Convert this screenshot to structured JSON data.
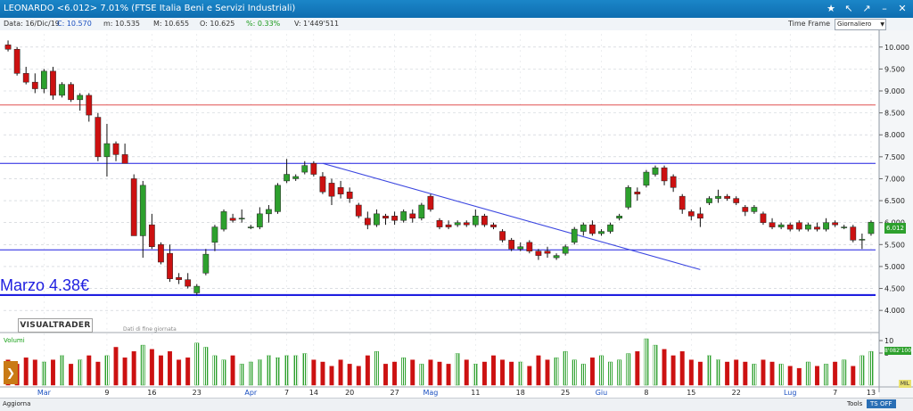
{
  "window": {
    "title": "LEONARDO <6.012> 7.01%   (FTSE Italia Beni e Servizi Industriali)"
  },
  "info": {
    "data": "Data: 16/Dic/19",
    "close": "C: 10.570",
    "min": "m: 10.535",
    "max": "M: 10.655",
    "open": "O: 10.625",
    "pct": "%: 0.33%",
    "volume": "V: 1'449'511"
  },
  "timeframe": {
    "label": "Time Frame",
    "value": "Giornaliero"
  },
  "logo": {
    "name": "VISUALTRADER",
    "sub": "Dati di fine giornata"
  },
  "annotation": "Marzo 4.38€",
  "volume_label": "Volumi",
  "status": {
    "aggiorna": "Aggiorna",
    "tools": "Tools",
    "tsoff": "TS OFF"
  },
  "tags": {
    "price": "6.012",
    "volume": "8'082'100",
    "mil": "MIL"
  },
  "colors": {
    "up": "#2da02d",
    "down": "#cc1111",
    "trend": "#3b46e0",
    "support": "#1f1fe0",
    "resistance": "#e05050"
  },
  "chart_data": {
    "type": "candlestick",
    "ylim": [
      3.8,
      10.3
    ],
    "yticks": [
      "10.000",
      "9.500",
      "9.000",
      "8.500",
      "8.000",
      "7.500",
      "7.000",
      "6.500",
      "6.000",
      "5.500",
      "5.000",
      "4.500",
      "4.000"
    ],
    "x_ticks": [
      {
        "label": "Mar",
        "i": 4
      },
      {
        "label": "9",
        "i": 11
      },
      {
        "label": "16",
        "i": 16
      },
      {
        "label": "23",
        "i": 21
      },
      {
        "label": "Apr",
        "i": 27
      },
      {
        "label": "7",
        "i": 31
      },
      {
        "label": "14",
        "i": 34
      },
      {
        "label": "20",
        "i": 38
      },
      {
        "label": "27",
        "i": 43
      },
      {
        "label": "Mag",
        "i": 47
      },
      {
        "label": "11",
        "i": 52
      },
      {
        "label": "18",
        "i": 57
      },
      {
        "label": "25",
        "i": 62
      },
      {
        "label": "Giu",
        "i": 66
      },
      {
        "label": "8",
        "i": 71
      },
      {
        "label": "15",
        "i": 76
      },
      {
        "label": "22",
        "i": 81
      },
      {
        "label": "Lug",
        "i": 87
      },
      {
        "label": "7",
        "i": 92
      },
      {
        "label": "13",
        "i": 96
      }
    ],
    "ohlc": [
      [
        10.05,
        10.15,
        9.9,
        9.95
      ],
      [
        9.95,
        10.0,
        9.35,
        9.4
      ],
      [
        9.4,
        9.55,
        9.15,
        9.2
      ],
      [
        9.2,
        9.4,
        8.95,
        9.05
      ],
      [
        9.05,
        9.5,
        8.95,
        9.45
      ],
      [
        9.45,
        9.55,
        8.8,
        8.9
      ],
      [
        8.9,
        9.2,
        8.85,
        9.15
      ],
      [
        9.15,
        9.2,
        8.75,
        8.8
      ],
      [
        8.8,
        8.95,
        8.55,
        8.9
      ],
      [
        8.9,
        8.95,
        8.3,
        8.45
      ],
      [
        8.4,
        8.5,
        7.4,
        7.5
      ],
      [
        7.5,
        8.25,
        7.05,
        7.8
      ],
      [
        7.8,
        7.85,
        7.4,
        7.55
      ],
      [
        7.55,
        7.8,
        7.4,
        7.35
      ],
      [
        7.0,
        7.1,
        5.7,
        5.7
      ],
      [
        5.7,
        6.95,
        5.2,
        6.85
      ],
      [
        5.95,
        6.2,
        5.4,
        5.45
      ],
      [
        5.5,
        5.55,
        5.05,
        5.1
      ],
      [
        5.3,
        5.5,
        4.65,
        4.72
      ],
      [
        4.75,
        4.85,
        4.6,
        4.7
      ],
      [
        4.7,
        4.85,
        4.5,
        4.55
      ],
      [
        4.4,
        4.6,
        4.35,
        4.55
      ],
      [
        4.85,
        5.4,
        4.8,
        5.28
      ],
      [
        5.55,
        5.95,
        5.35,
        5.9
      ],
      [
        5.85,
        6.3,
        5.8,
        6.25
      ],
      [
        6.1,
        6.2,
        6.0,
        6.05
      ],
      [
        6.1,
        6.3,
        6.0,
        6.1
      ],
      [
        5.9,
        5.95,
        5.85,
        5.9
      ],
      [
        5.9,
        6.35,
        5.85,
        6.2
      ],
      [
        6.2,
        6.4,
        6.0,
        6.3
      ],
      [
        6.25,
        6.9,
        6.2,
        6.85
      ],
      [
        6.95,
        7.45,
        6.9,
        7.1
      ],
      [
        7.0,
        7.1,
        6.95,
        7.05
      ],
      [
        7.15,
        7.4,
        7.1,
        7.3
      ],
      [
        7.35,
        7.4,
        7.05,
        7.1
      ],
      [
        7.05,
        7.15,
        6.65,
        6.7
      ],
      [
        6.9,
        7.0,
        6.4,
        6.6
      ],
      [
        6.8,
        6.95,
        6.55,
        6.65
      ],
      [
        6.7,
        6.8,
        6.45,
        6.55
      ],
      [
        6.4,
        6.45,
        6.1,
        6.15
      ],
      [
        6.1,
        6.25,
        5.85,
        5.95
      ],
      [
        5.95,
        6.3,
        5.9,
        6.2
      ],
      [
        6.15,
        6.2,
        5.95,
        6.1
      ],
      [
        6.15,
        6.25,
        5.95,
        6.05
      ],
      [
        6.05,
        6.3,
        6.0,
        6.25
      ],
      [
        6.2,
        6.3,
        6.0,
        6.1
      ],
      [
        6.1,
        6.45,
        6.05,
        6.4
      ],
      [
        6.6,
        6.65,
        6.25,
        6.3
      ],
      [
        6.05,
        6.1,
        5.85,
        5.9
      ],
      [
        5.95,
        6.05,
        5.85,
        5.9
      ],
      [
        5.95,
        6.05,
        5.9,
        6.0
      ],
      [
        6.0,
        6.05,
        5.9,
        5.95
      ],
      [
        5.95,
        6.3,
        5.9,
        6.15
      ],
      [
        6.15,
        6.2,
        5.9,
        5.95
      ],
      [
        5.95,
        6.0,
        5.85,
        5.9
      ],
      [
        5.8,
        5.85,
        5.55,
        5.6
      ],
      [
        5.6,
        5.65,
        5.35,
        5.4
      ],
      [
        5.4,
        5.55,
        5.35,
        5.45
      ],
      [
        5.55,
        5.6,
        5.3,
        5.35
      ],
      [
        5.35,
        5.4,
        5.15,
        5.25
      ],
      [
        5.35,
        5.45,
        5.2,
        5.3
      ],
      [
        5.2,
        5.3,
        5.15,
        5.25
      ],
      [
        5.3,
        5.5,
        5.25,
        5.45
      ],
      [
        5.55,
        5.9,
        5.5,
        5.85
      ],
      [
        5.8,
        6.0,
        5.7,
        5.95
      ],
      [
        5.95,
        6.05,
        5.7,
        5.75
      ],
      [
        5.75,
        5.85,
        5.7,
        5.8
      ],
      [
        5.8,
        6.0,
        5.75,
        5.95
      ],
      [
        6.1,
        6.2,
        6.05,
        6.15
      ],
      [
        6.35,
        6.85,
        6.3,
        6.8
      ],
      [
        6.7,
        6.8,
        6.5,
        6.65
      ],
      [
        6.85,
        7.2,
        6.8,
        7.15
      ],
      [
        7.1,
        7.3,
        7.05,
        7.25
      ],
      [
        7.25,
        7.3,
        6.85,
        6.95
      ],
      [
        7.05,
        7.1,
        6.7,
        6.8
      ],
      [
        6.6,
        6.65,
        6.2,
        6.3
      ],
      [
        6.25,
        6.3,
        6.05,
        6.15
      ],
      [
        6.2,
        6.35,
        5.9,
        6.1
      ],
      [
        6.45,
        6.6,
        6.4,
        6.55
      ],
      [
        6.55,
        6.75,
        6.45,
        6.6
      ],
      [
        6.6,
        6.65,
        6.5,
        6.55
      ],
      [
        6.55,
        6.6,
        6.4,
        6.45
      ],
      [
        6.35,
        6.4,
        6.15,
        6.25
      ],
      [
        6.25,
        6.4,
        6.2,
        6.35
      ],
      [
        6.2,
        6.25,
        5.95,
        6.0
      ],
      [
        6.0,
        6.1,
        5.85,
        5.9
      ],
      [
        5.9,
        6.0,
        5.85,
        5.95
      ],
      [
        5.95,
        6.0,
        5.8,
        5.85
      ],
      [
        6.0,
        6.05,
        5.8,
        5.85
      ],
      [
        5.85,
        6.0,
        5.8,
        5.95
      ],
      [
        5.9,
        6.0,
        5.8,
        5.85
      ],
      [
        5.85,
        6.1,
        5.8,
        6.0
      ],
      [
        6.0,
        6.05,
        5.9,
        5.95
      ],
      [
        5.9,
        5.95,
        5.85,
        5.9
      ],
      [
        5.9,
        5.95,
        5.55,
        5.6
      ],
      [
        5.6,
        5.75,
        5.4,
        5.62
      ],
      [
        5.75,
        6.05,
        5.7,
        6.01
      ]
    ],
    "volume_ratio": [
      0.6,
      0.5,
      0.65,
      0.6,
      0.55,
      0.6,
      0.7,
      0.5,
      0.6,
      0.7,
      0.55,
      0.7,
      0.9,
      0.65,
      0.8,
      0.95,
      0.85,
      0.7,
      0.8,
      0.6,
      0.65,
      1.0,
      0.9,
      0.7,
      0.6,
      0.7,
      0.5,
      0.55,
      0.6,
      0.7,
      0.65,
      0.7,
      0.7,
      0.75,
      0.6,
      0.55,
      0.45,
      0.6,
      0.5,
      0.45,
      0.7,
      0.8,
      0.5,
      0.55,
      0.65,
      0.6,
      0.5,
      0.6,
      0.55,
      0.5,
      0.75,
      0.6,
      0.5,
      0.55,
      0.7,
      0.6,
      0.55,
      0.55,
      0.45,
      0.7,
      0.6,
      0.65,
      0.8,
      0.6,
      0.5,
      0.65,
      0.7,
      0.55,
      0.6,
      0.75,
      0.8,
      1.1,
      0.95,
      0.85,
      0.7,
      0.8,
      0.6,
      0.55,
      0.7,
      0.6,
      0.55,
      0.6,
      0.55,
      0.5,
      0.6,
      0.55,
      0.5,
      0.45,
      0.4,
      0.55,
      0.45,
      0.5,
      0.55,
      0.6,
      0.45,
      0.7,
      0.8,
      0.9
    ],
    "volume_ticks": [
      "10",
      "5"
    ],
    "support_levels": [
      5.38,
      7.35,
      4.35
    ],
    "resistance_level": 8.68,
    "trendline": [
      [
        35,
        7.35
      ],
      [
        77,
        4.93
      ]
    ]
  }
}
